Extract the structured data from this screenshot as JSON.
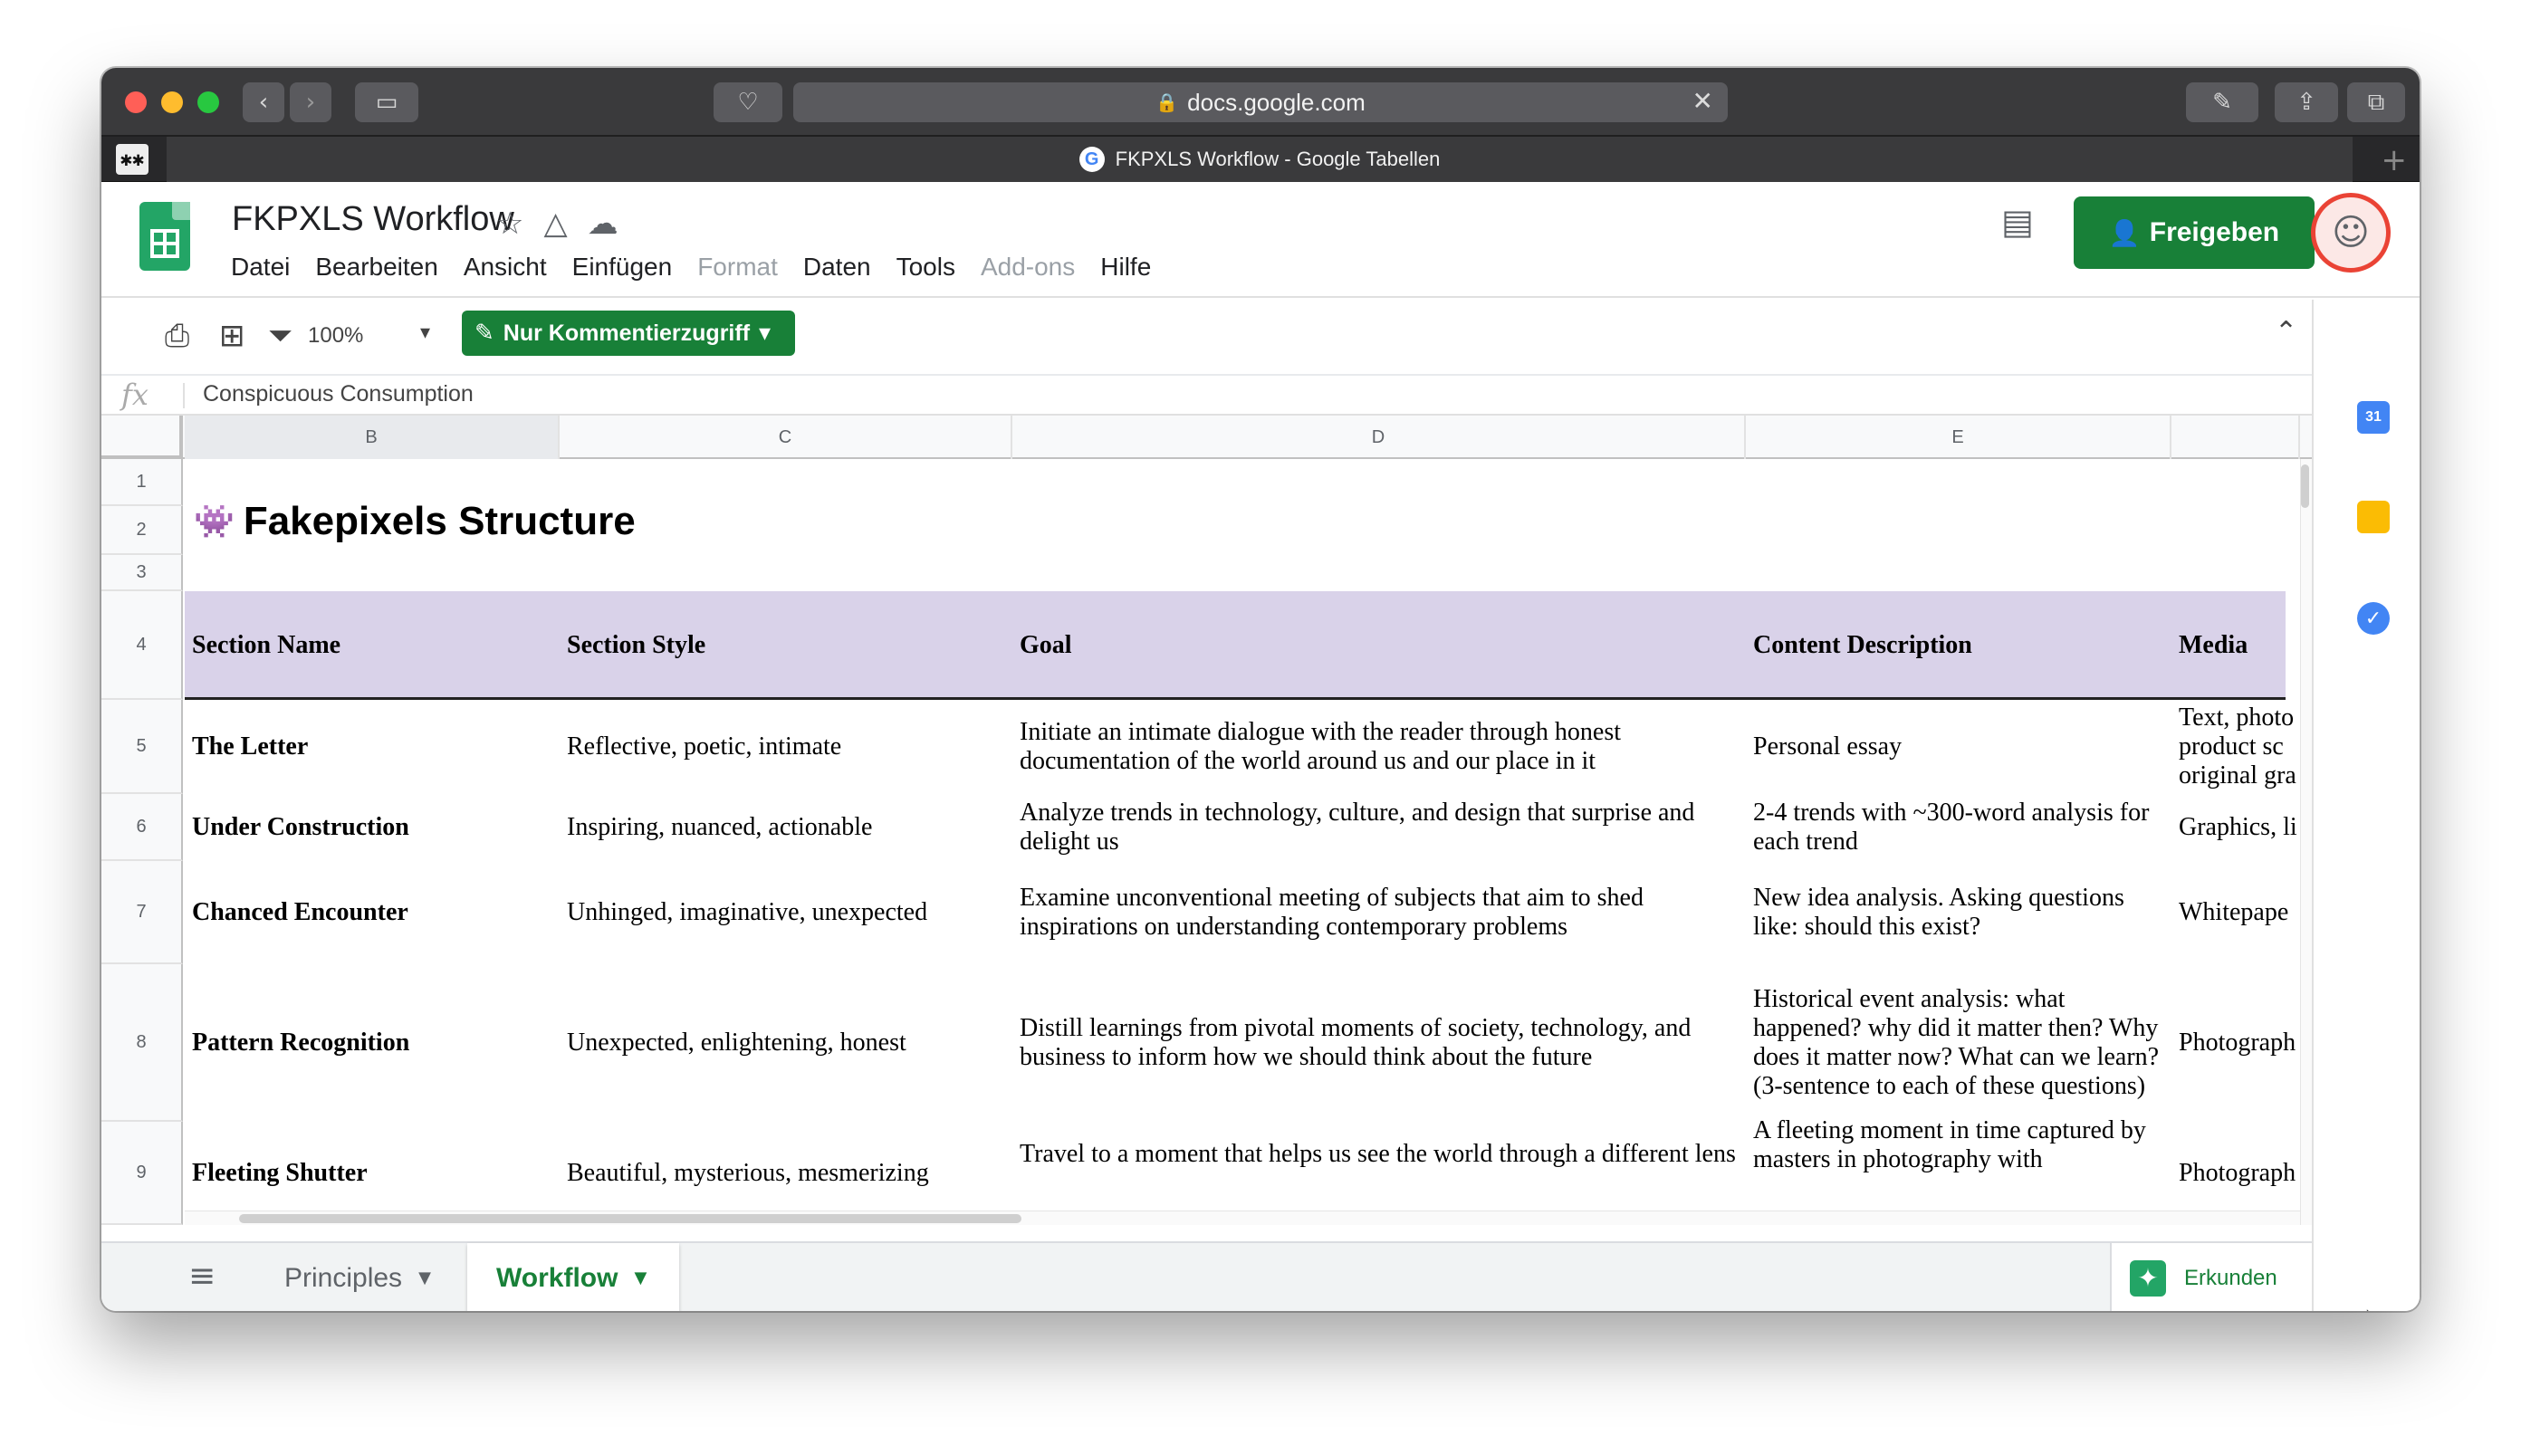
{
  "browser": {
    "url": "docs.google.com",
    "tab_title": "FKPXLS Workflow - Google Tabellen",
    "pinned_tab_icon": "✱✱"
  },
  "doc": {
    "title": "FKPXLS Workflow",
    "menu": [
      "Datei",
      "Bearbeiten",
      "Ansicht",
      "Einfügen",
      "Format",
      "Daten",
      "Tools",
      "Add-ons",
      "Hilfe"
    ],
    "share_label": "Freigeben"
  },
  "toolbar": {
    "zoom": "100%",
    "access_label": "Nur Kommentierzugriff"
  },
  "formula_bar": {
    "fx": "fx",
    "value": "Conspicuous Consumption"
  },
  "grid": {
    "columns": [
      "B",
      "C",
      "D",
      "E"
    ],
    "rows": [
      "1",
      "2",
      "3",
      "4",
      "5",
      "6",
      "7",
      "8",
      "9"
    ],
    "title": "Fakepixels Structure",
    "headers": [
      "Section Name",
      "Section Style",
      "Goal",
      "Content Description",
      "Media"
    ],
    "data": [
      [
        "The Letter",
        "Reflective, poetic, intimate",
        "Initiate an intimate dialogue with the reader through honest documentation of the world around us and our place in it",
        "Personal essay",
        "Text, photo product sc original gra"
      ],
      [
        "Under Construction",
        "Inspiring, nuanced, actionable",
        "Analyze trends in technology, culture, and design that surprise and delight us",
        "2-4 trends with ~300-word analysis for each trend",
        "Graphics, li"
      ],
      [
        "Chanced Encounter",
        "Unhinged, imaginative, unexpected",
        "Examine unconventional meeting of subjects that aim to shed inspirations on understanding contemporary problems",
        "New idea analysis. Asking questions like: should this exist?",
        "Whitepape"
      ],
      [
        "Pattern Recognition",
        "Unexpected, enlightening, honest",
        "Distill learnings from pivotal moments of society, technology, and business to inform how we should think about the future",
        "Historical event analysis: what happened? why did it matter then? Why does it matter now? What can we learn? (3-sentence to each of these questions)",
        "Photograph"
      ],
      [
        "Fleeting Shutter",
        "Beautiful, mysterious, mesmerizing",
        "Travel to a moment that helps us see the world through a different lens",
        "A fleeting moment in time captured by masters in photography with",
        "Photograph"
      ]
    ]
  },
  "sheets": {
    "tabs": [
      "Principles",
      "Workflow"
    ],
    "active": "Workflow",
    "explore_label": "Erkunden"
  },
  "colors": {
    "accent_green": "#188038",
    "header_purple": "#d9d2e9"
  }
}
